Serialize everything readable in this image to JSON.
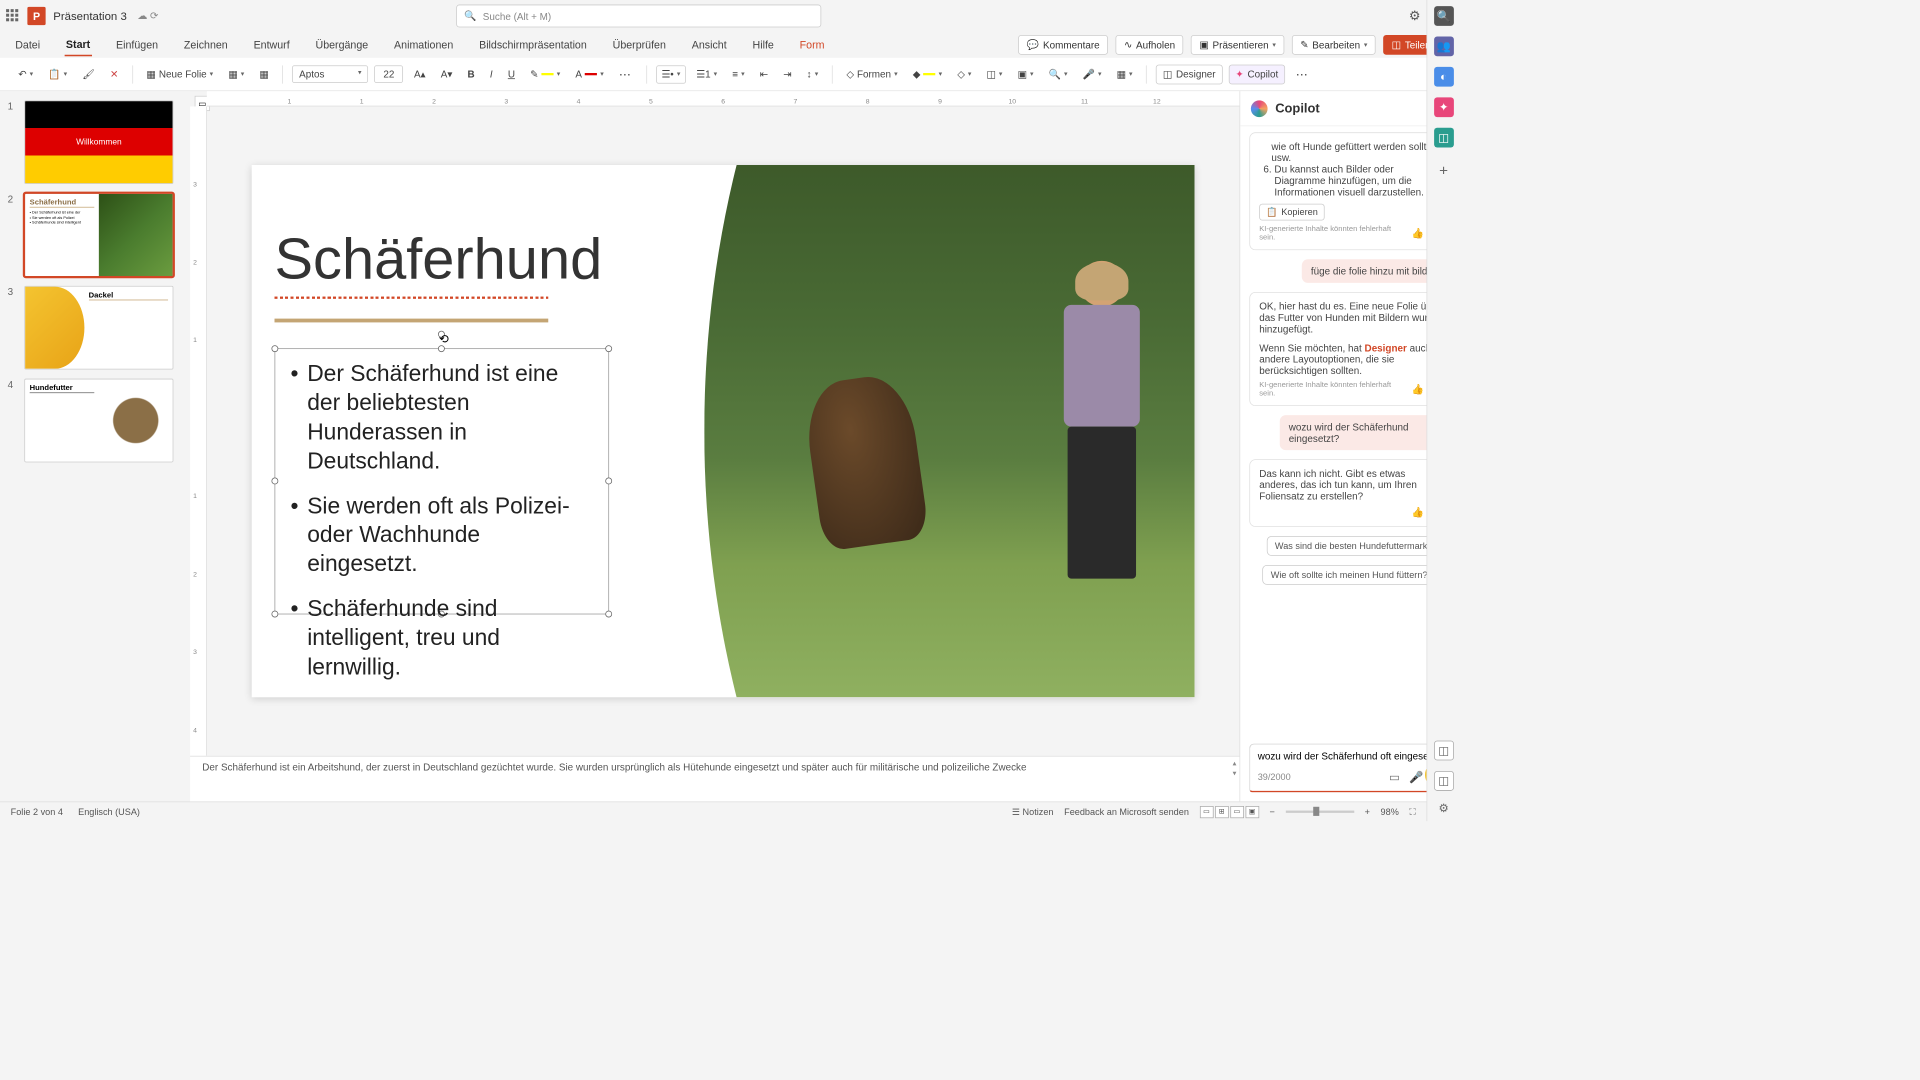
{
  "titlebar": {
    "presentation": "Präsentation 3",
    "search_placeholder": "Suche (Alt + M)"
  },
  "ribbon": {
    "tabs": [
      "Datei",
      "Start",
      "Einfügen",
      "Zeichnen",
      "Entwurf",
      "Übergänge",
      "Animationen",
      "Bildschirmpräsentation",
      "Überprüfen",
      "Ansicht",
      "Hilfe",
      "Form"
    ],
    "comments": "Kommentare",
    "catchup": "Aufholen",
    "present": "Präsentieren",
    "edit": "Bearbeiten",
    "share": "Teilen"
  },
  "toolbar": {
    "new_slide": "Neue Folie",
    "font_name": "Aptos",
    "font_size": "22",
    "shapes": "Formen",
    "designer": "Designer",
    "copilot": "Copilot"
  },
  "thumbs": {
    "t1": "Willkommen",
    "t2": "Schäferhund",
    "t3": "Dackel",
    "t4": "Hundefutter"
  },
  "slide": {
    "title": "Schäferhund",
    "b1": "Der Schäferhund ist eine der beliebtesten Hunderassen in Deutschland.",
    "b2": "Sie werden oft als Polizei- oder Wachhunde eingesetzt.",
    "b3": "Schäferhunde sind intelligent, treu und lernwillig."
  },
  "notes": {
    "text": "Der Schäferhund ist ein Arbeitshund, der zuerst in Deutschland gezüchtet wurde. Sie wurden ursprünglich als Hütehunde eingesetzt und später auch für militärische und polizeiliche Zwecke"
  },
  "copilot": {
    "title": "Copilot",
    "card1_line1": "wie oft Hunde gefüttert werden sollten usw.",
    "card1_line2": "Du kannst auch Bilder oder Diagramme hinzufügen, um die Informationen visuell darzustellen.",
    "copy": "Kopieren",
    "disclaimer": "KI-generierte Inhalte könnten fehlerhaft sein.",
    "user1": "füge die folie hinzu mit bildern",
    "resp1": "OK, hier hast du es. Eine neue Folie über das Futter von Hunden mit Bildern wurde hinzugefügt.",
    "resp2a": "Wenn Sie möchten, hat ",
    "resp2b": "Designer",
    "resp2c": " auch andere Layoutoptionen, die sie berücksichtigen sollten.",
    "user2": "wozu wird der Schäferhund eingesetzt?",
    "resp3": "Das kann ich nicht. Gibt es etwas anderes, das ich tun kann, um Ihren Foliensatz zu erstellen?",
    "sugg1": "Was sind die besten Hundefuttermarken?",
    "sugg2": "Wie oft sollte ich meinen Hund füttern?",
    "input_text": "wozu wird der Schäferhund oft eingesetzt",
    "counter": "39/2000"
  },
  "status": {
    "slide": "Folie 2 von 4",
    "lang": "Englisch (USA)",
    "notes": "Notizen",
    "feedback": "Feedback an Microsoft senden",
    "zoom": "98%"
  }
}
